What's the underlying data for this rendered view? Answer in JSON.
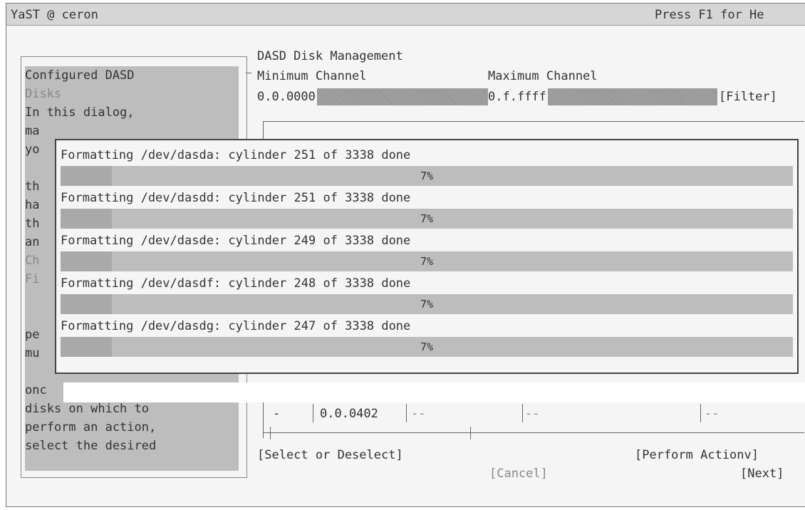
{
  "title_bar": {
    "left": "YaST @ ceron",
    "right": "Press F1 for He"
  },
  "help_panel": {
    "lines": [
      "  Configured DASD",
      "Disks",
      "In this dialog,",
      "ma",
      "yo",
      "",
      "th",
      "ha",
      "th",
      "an",
      "Ch",
      "Fi",
      "",
      "pe",
      "mu",
      "onc",
      "disks on which to",
      "perform an action,",
      "select the desired"
    ]
  },
  "main": {
    "heading": "DASD Disk Management",
    "min_label": "Minimum Channel",
    "max_label": "Maximum Channel",
    "min_value": "0.0.0000",
    "max_value": "0.f.ffff",
    "filter_button": "[Filter]",
    "row": {
      "col1": "-",
      "col2": "0.0.0402",
      "col3": "--",
      "col4": "--",
      "col5": "--"
    },
    "select_button": "[Select or Deselect]",
    "perform_button": "[Perform Actionv]",
    "cancel_button": "[Cancel]",
    "next_button": "[Next]"
  },
  "popup": {
    "items": [
      {
        "label": "Formatting /dev/dasda: cylinder 251 of 3338 done",
        "percent_text": "7%",
        "progress": 0.07
      },
      {
        "label": "Formatting /dev/dasdd: cylinder 251 of 3338 done",
        "percent_text": "7%",
        "progress": 0.07
      },
      {
        "label": "Formatting /dev/dasde: cylinder 249 of 3338 done",
        "percent_text": "7%",
        "progress": 0.07
      },
      {
        "label": "Formatting /dev/dasdf: cylinder 248 of 3338 done",
        "percent_text": "7%",
        "progress": 0.07
      },
      {
        "label": "Formatting /dev/dasdg: cylinder 247 of 3338 done",
        "percent_text": "7%",
        "progress": 0.07
      }
    ]
  }
}
